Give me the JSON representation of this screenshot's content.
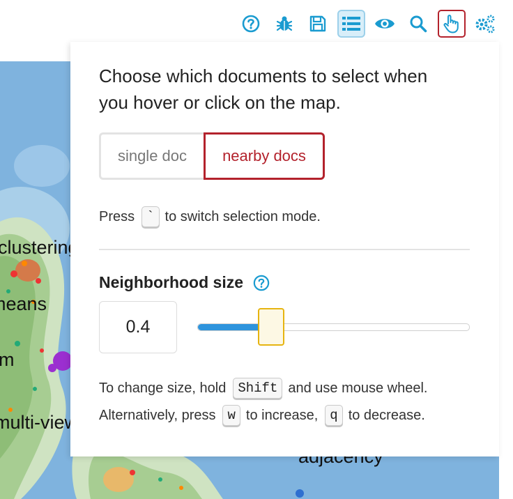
{
  "toolbar": {
    "items": [
      {
        "icon": "help-icon"
      },
      {
        "icon": "bug-icon"
      },
      {
        "icon": "save-icon"
      },
      {
        "icon": "list-icon",
        "state": "active"
      },
      {
        "icon": "eye-icon"
      },
      {
        "icon": "search-icon"
      },
      {
        "icon": "pointer-hand-icon",
        "state": "selected-mode"
      },
      {
        "icon": "settings-icon"
      }
    ],
    "icon_color": "#1a9bd0"
  },
  "map": {
    "labels": [
      "clustering",
      "means",
      "m",
      "multi-view",
      "adjacency"
    ]
  },
  "panel": {
    "title": "Choose which documents to select when you hover or click on the map.",
    "mode": {
      "options": [
        "single doc",
        "nearby docs"
      ],
      "selected": "nearby docs"
    },
    "switch_hint": {
      "prefix": "Press",
      "key": "`",
      "suffix": "to switch selection mode."
    },
    "neighborhood": {
      "label": "Neighborhood size",
      "value": "0.4",
      "slider_fraction": 0.27
    },
    "size_hint": {
      "line1_prefix": "To change size, hold",
      "line1_key": "Shift",
      "line1_suffix": "and use mouse wheel.",
      "line2_prefix": "Alternatively, press",
      "line2_key1": "w",
      "line2_mid": "to increase,",
      "line2_key2": "q",
      "line2_suffix": "to decrease."
    }
  },
  "colors": {
    "accent_red": "#b3222c",
    "accent_blue": "#2e94dd",
    "handle_yellow": "#e6b410"
  }
}
